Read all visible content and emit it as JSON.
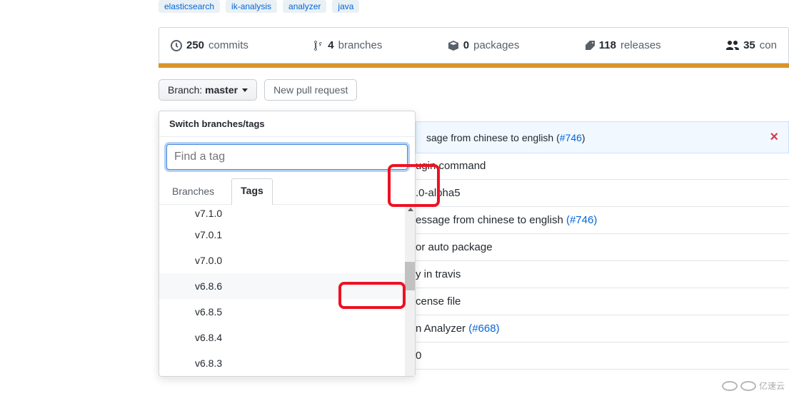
{
  "topics": [
    "elasticsearch",
    "ik-analysis",
    "analyzer",
    "java"
  ],
  "summary": {
    "commits": {
      "count": "250",
      "label": "commits"
    },
    "branches": {
      "count": "4",
      "label": "branches"
    },
    "packages": {
      "count": "0",
      "label": "packages"
    },
    "releases": {
      "count": "118",
      "label": "releases"
    },
    "contributors": {
      "count": "35",
      "label": "con"
    }
  },
  "toolbar": {
    "branch_prefix": "Branch:",
    "branch_name": "master",
    "new_pr": "New pull request"
  },
  "dropdown": {
    "title": "Switch branches/tags",
    "placeholder": "Find a tag",
    "tab_branches": "Branches",
    "tab_tags": "Tags",
    "items": [
      "v7.1.0",
      "v7.0.1",
      "v7.0.0",
      "v6.8.6",
      "v6.8.5",
      "v6.8.4",
      "v6.8.3"
    ],
    "highlighted_item": "v6.8.6"
  },
  "banner": {
    "text_prefix": "sage from chinese to english (",
    "issue": "#746",
    "text_suffix": ")"
  },
  "rows": [
    {
      "text": "ugin command"
    },
    {
      "text": ".0-alpha5"
    },
    {
      "text": "essage from chinese to english (#746)",
      "link_part": "(#746)"
    },
    {
      "text": "or auto package"
    },
    {
      "text": "y in travis"
    },
    {
      "text": "cense file"
    },
    {
      "text": "n Analyzer (#668)",
      "link_part": "(#668)"
    },
    {
      "text": "0"
    }
  ],
  "watermark": "亿速云"
}
